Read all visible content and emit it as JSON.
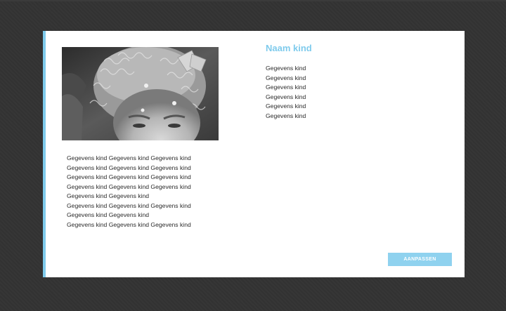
{
  "colors": {
    "background": "#333333",
    "card": "#ffffff",
    "accent": "#7fcbec",
    "button": "#8fd2ef",
    "text": "#2b2b2b"
  },
  "profile": {
    "name": "Naam kind",
    "photo_icon": "child-portrait-photo"
  },
  "details_list": [
    "Gegevens kind",
    "Gegevens kind",
    "Gegevens kind",
    "Gegevens kind",
    "Gegevens kind",
    "Gegevens kind"
  ],
  "description_lines": [
    "Gegevens kind Gegevens kind Gegevens kind",
    "Gegevens kind Gegevens kind Gegevens kind",
    "Gegevens kind Gegevens kind Gegevens kind",
    "Gegevens kind Gegevens kind Gegevens kind",
    "Gegevens kind Gegevens kind",
    "Gegevens kind Gegevens kind Gegevens kind",
    "Gegevens kind Gegevens kind",
    "Gegevens kind Gegevens kind Gegevens kind"
  ],
  "actions": {
    "edit_label": "AANPASSEN"
  }
}
